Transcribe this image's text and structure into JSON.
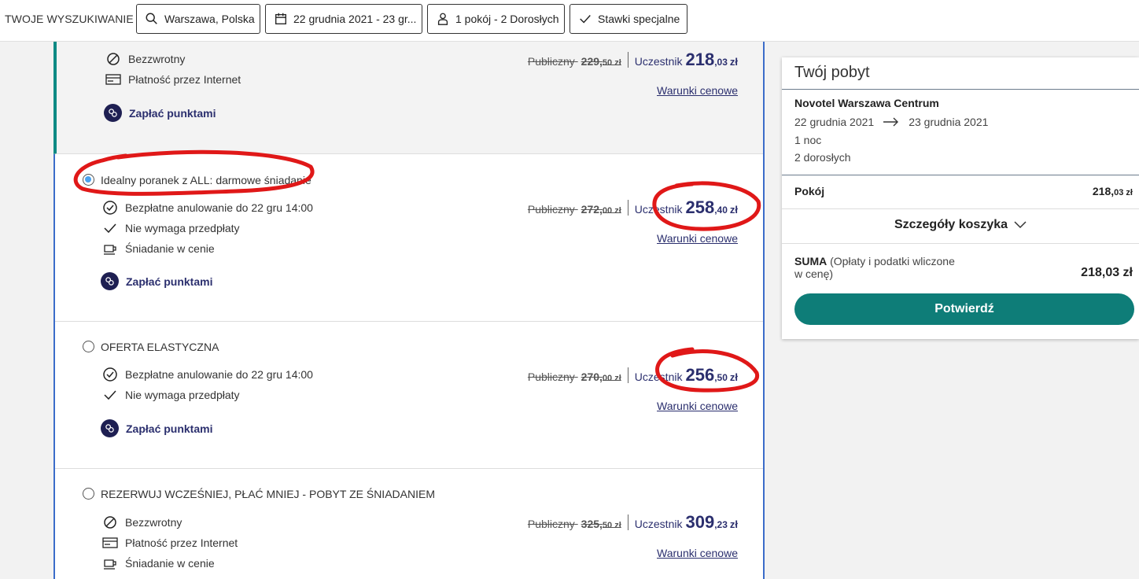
{
  "search": {
    "label": "TWOJE WYSZUKIWANIE",
    "location": "Warszawa, Polska",
    "dates": "22 grudnia 2021 - 23 gr...",
    "guests": "1 pokój - 2 Dorosłych",
    "special": "Stawki specjalne"
  },
  "offers": [
    {
      "title": "",
      "features": [
        {
          "icon": "no-entry-icon",
          "text": "Bezzwrotny"
        },
        {
          "icon": "card-icon",
          "text": "Płatność przez Internet"
        }
      ],
      "pay_points": "Zapłać punktami",
      "public_label": "Publiczny",
      "public_int": "229,",
      "public_dec": "50 zł",
      "member_label": "Uczestnik",
      "member_int": "218",
      "member_dec": ",03",
      "currency": "zł",
      "terms": "Warunki cenowe"
    },
    {
      "title": "Idealny poranek z ALL: darmowe śniadanie",
      "selected": true,
      "features": [
        {
          "icon": "clock-check-icon",
          "text": "Bezpłatne anulowanie do 22 gru 14:00"
        },
        {
          "icon": "check-icon",
          "text": "Nie wymaga przedpłaty"
        },
        {
          "icon": "cup-icon",
          "text": "Śniadanie w cenie"
        }
      ],
      "pay_points": "Zapłać punktami",
      "public_label": "Publiczny",
      "public_int": "272,",
      "public_dec": "00 zł",
      "member_label": "Uczestnik",
      "member_int": "258",
      "member_dec": ",40",
      "currency": "zł",
      "terms": "Warunki cenowe"
    },
    {
      "title": "OFERTA ELASTYCZNA",
      "selected": false,
      "features": [
        {
          "icon": "clock-check-icon",
          "text": "Bezpłatne anulowanie do 22 gru 14:00"
        },
        {
          "icon": "check-icon",
          "text": "Nie wymaga przedpłaty"
        }
      ],
      "pay_points": "Zapłać punktami",
      "public_label": "Publiczny",
      "public_int": "270,",
      "public_dec": "00 zł",
      "member_label": "Uczestnik",
      "member_int": "256",
      "member_dec": ",50",
      "currency": "zł",
      "terms": "Warunki cenowe"
    },
    {
      "title": "REZERWUJ WCZEŚNIEJ, PŁAĆ MNIEJ - POBYT ZE ŚNIADANIEM",
      "selected": false,
      "features": [
        {
          "icon": "no-entry-icon",
          "text": "Bezzwrotny"
        },
        {
          "icon": "card-icon",
          "text": "Płatność przez Internet"
        },
        {
          "icon": "cup-icon",
          "text": "Śniadanie w cenie"
        }
      ],
      "public_label": "Publiczny",
      "public_int": "325,",
      "public_dec": "50 zł",
      "member_label": "Uczestnik",
      "member_int": "309",
      "member_dec": ",23",
      "currency": "zł",
      "terms": "Warunki cenowe"
    }
  ],
  "summary": {
    "title": "Twój pobyt",
    "hotel": "Novotel Warszawa Centrum",
    "date_from": "22 grudnia 2021",
    "date_to": "23 grudnia 2021",
    "nights": "1 noc",
    "adults": "2 dorosłych",
    "room_label": "Pokój",
    "room_price_int": "218,",
    "room_price_dec": "03 zł",
    "cart_label": "Szczegóły koszyka",
    "sum_label": "SUMA",
    "sum_note_1": " (Opłaty i podatki wliczone",
    "sum_note_2": "w cenę)",
    "sum_total": "218,03 zł",
    "confirm": "Potwierdź"
  },
  "colors": {
    "accent_teal": "#0e7d78",
    "brand_navy": "#2b2f6e",
    "panel_border": "#3b6cc9",
    "annotation_red": "#e01818"
  }
}
